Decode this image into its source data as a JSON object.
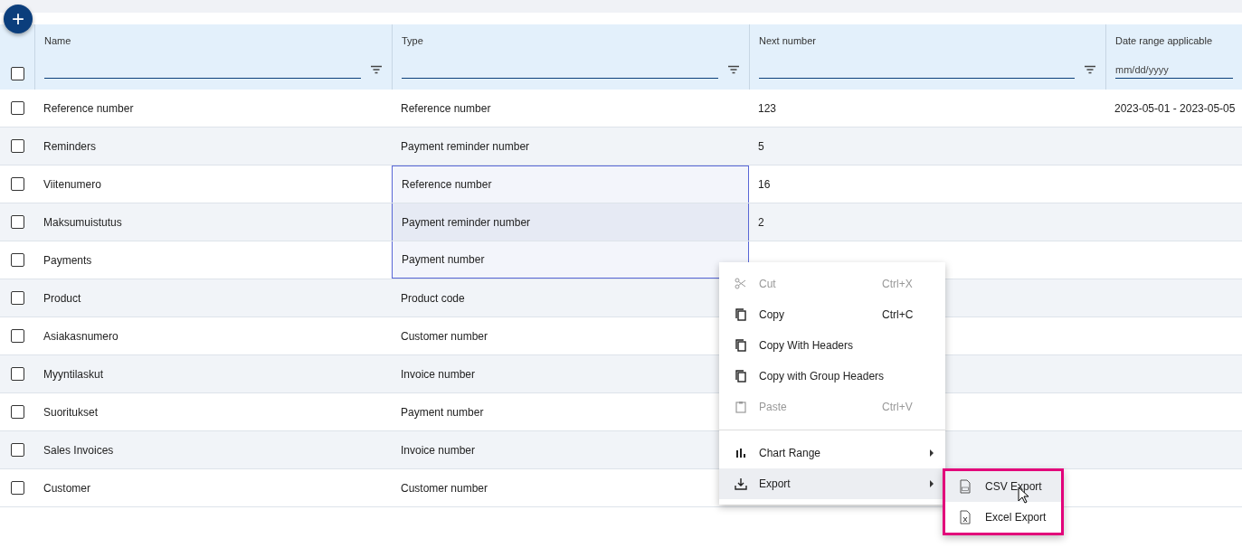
{
  "add_button": {
    "label": "+"
  },
  "table": {
    "columns": [
      {
        "label": "Name",
        "kind": "text"
      },
      {
        "label": "Type",
        "kind": "text"
      },
      {
        "label": "Next number",
        "kind": "text"
      },
      {
        "label": "Date range applicable",
        "kind": "date",
        "placeholder": "mm/dd/yyyy"
      }
    ],
    "select_all": {
      "checked": false
    },
    "rows": [
      {
        "checked": false,
        "cells": [
          "Reference number",
          "Reference number",
          "123",
          "2023-05-01 - 2023-05-05"
        ],
        "type_selected": false
      },
      {
        "checked": false,
        "cells": [
          "Reminders",
          "Payment reminder number",
          "5",
          ""
        ],
        "type_selected": false
      },
      {
        "checked": false,
        "cells": [
          "Viitenumero",
          "Reference number",
          "16",
          ""
        ],
        "type_selected": true
      },
      {
        "checked": false,
        "cells": [
          "Maksumuistutus",
          "Payment reminder number",
          "2",
          ""
        ],
        "type_selected": true
      },
      {
        "checked": false,
        "cells": [
          "Payments",
          "Payment number",
          "",
          ""
        ],
        "type_selected": true
      },
      {
        "checked": false,
        "cells": [
          "Product",
          "Product code",
          "",
          ""
        ],
        "type_selected": false
      },
      {
        "checked": false,
        "cells": [
          "Asiakasnumero",
          "Customer number",
          "",
          ""
        ],
        "type_selected": false
      },
      {
        "checked": false,
        "cells": [
          "Myyntilaskut",
          "Invoice number",
          "",
          ""
        ],
        "type_selected": false
      },
      {
        "checked": false,
        "cells": [
          "Suoritukset",
          "Payment number",
          "",
          ""
        ],
        "type_selected": false
      },
      {
        "checked": false,
        "cells": [
          "Sales Invoices",
          "Invoice number",
          "",
          ""
        ],
        "type_selected": false
      },
      {
        "checked": false,
        "cells": [
          "Customer",
          "Customer number",
          "",
          ""
        ],
        "type_selected": false
      }
    ]
  },
  "context_menu": {
    "items": [
      {
        "kind": "item",
        "label": "Cut",
        "shortcut": "Ctrl+X",
        "disabled": true,
        "submenu": false,
        "selected": false
      },
      {
        "kind": "item",
        "label": "Copy",
        "shortcut": "Ctrl+C",
        "disabled": false,
        "submenu": false,
        "selected": false
      },
      {
        "kind": "item",
        "label": "Copy With Headers",
        "disabled": false,
        "submenu": false,
        "selected": false
      },
      {
        "kind": "item",
        "label": "Copy with Group Headers",
        "disabled": false,
        "submenu": false,
        "selected": false
      },
      {
        "kind": "item",
        "label": "Paste",
        "shortcut": "Ctrl+V",
        "disabled": true,
        "submenu": false,
        "selected": false
      },
      {
        "kind": "separator"
      },
      {
        "kind": "item",
        "label": "Chart Range",
        "disabled": false,
        "submenu": true,
        "selected": false
      },
      {
        "kind": "item",
        "label": "Export",
        "disabled": false,
        "submenu": true,
        "selected": true
      }
    ]
  },
  "submenu": {
    "highlighted": true,
    "items": [
      {
        "label": "CSV Export",
        "selected": true
      },
      {
        "label": "Excel Export",
        "selected": false
      }
    ]
  }
}
